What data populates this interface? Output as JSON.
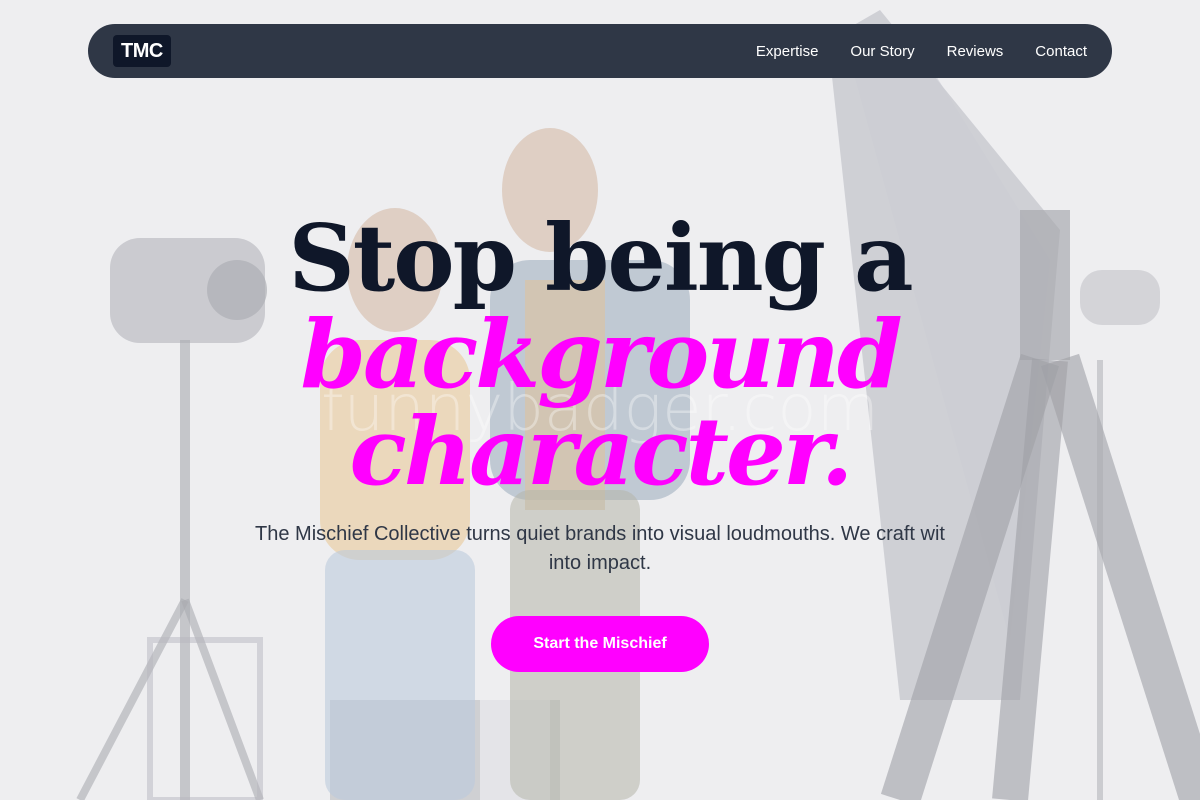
{
  "nav": {
    "logo": "TMC",
    "links": [
      "Expertise",
      "Our Story",
      "Reviews",
      "Contact"
    ]
  },
  "hero": {
    "headline_line1": "Stop being a",
    "headline_line2": "background",
    "headline_line3": "character.",
    "tagline": "The Mischief Collective turns quiet brands into visual loudmouths. We craft wit into impact.",
    "cta_label": "Start the Mischief",
    "watermark": "funnybadger.com"
  },
  "colors": {
    "accent": "#ff00ff",
    "nav_bg": "#2f3746",
    "headline": "#0f1729"
  }
}
